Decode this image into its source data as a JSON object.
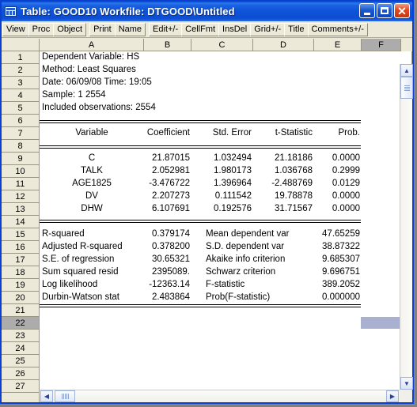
{
  "window": {
    "title": "Table: GOOD10   Workfile: DTGOOD\\Untitled",
    "icon": "table-icon",
    "buttons": {
      "minimize": "minimize",
      "maximize": "maximize",
      "close": "close"
    },
    "accent_color": "#0d4ed3",
    "close_color": "#c63711",
    "face_color": "#ece9d8"
  },
  "toolbar": {
    "groups": [
      [
        "View",
        "Proc",
        "Object"
      ],
      [
        "Print",
        "Name"
      ],
      [
        "Edit+/-",
        "CellFmt",
        "InsDel",
        "Grid+/-",
        "Title",
        "Comments+/-"
      ]
    ]
  },
  "sheet": {
    "columns": [
      "A",
      "B",
      "C",
      "D",
      "E",
      "F"
    ],
    "selected_column": "F",
    "selected_row": "22",
    "selected_cell": "F22",
    "selection_color": "#a9b0d0",
    "row_numbers": [
      "1",
      "2",
      "3",
      "4",
      "5",
      "6",
      "7",
      "8",
      "9",
      "10",
      "11",
      "12",
      "13",
      "14",
      "15",
      "16",
      "17",
      "18",
      "19",
      "20",
      "21",
      "22",
      "23",
      "24",
      "25",
      "26",
      "27"
    ]
  },
  "report": {
    "header_lines": [
      "Dependent Variable: HS",
      "Method: Least Squares",
      "Date: 06/09/08   Time: 19:05",
      "Sample: 1 2554",
      "Included observations: 2554"
    ],
    "table_headers": [
      "Variable",
      "Coefficient",
      "Std. Error",
      "t-Statistic",
      "Prob."
    ],
    "coefficients": [
      {
        "variable": "C",
        "coefficient": "21.87015",
        "std_error": "1.032494",
        "t_statistic": "21.18186",
        "prob": "0.0000"
      },
      {
        "variable": "TALK",
        "coefficient": "2.052981",
        "std_error": "1.980173",
        "t_statistic": "1.036768",
        "prob": "0.2999"
      },
      {
        "variable": "AGE1825",
        "coefficient": "-3.476722",
        "std_error": "1.396964",
        "t_statistic": "-2.488769",
        "prob": "0.0129"
      },
      {
        "variable": "DV",
        "coefficient": "2.207273",
        "std_error": "0.111542",
        "t_statistic": "19.78878",
        "prob": "0.0000"
      },
      {
        "variable": "DHW",
        "coefficient": "6.107691",
        "std_error": "0.192576",
        "t_statistic": "31.71567",
        "prob": "0.0000"
      }
    ],
    "summary": [
      {
        "left_label": "R-squared",
        "left_value": "0.379174",
        "right_label": "Mean dependent var",
        "right_value": "47.65259"
      },
      {
        "left_label": "Adjusted R-squared",
        "left_value": "0.378200",
        "right_label": "S.D. dependent var",
        "right_value": "38.87322"
      },
      {
        "left_label": "S.E. of regression",
        "left_value": "30.65321",
        "right_label": "Akaike info criterion",
        "right_value": "9.685307"
      },
      {
        "left_label": "Sum squared resid",
        "left_value": "2395089.",
        "right_label": "Schwarz criterion",
        "right_value": "9.696751"
      },
      {
        "left_label": "Log likelihood",
        "left_value": "-12363.14",
        "right_label": "F-statistic",
        "right_value": "389.2052"
      },
      {
        "left_label": "Durbin-Watson stat",
        "left_value": "2.483864",
        "right_label": "Prob(F-statistic)",
        "right_value": "0.000000"
      }
    ]
  },
  "chart_data": {
    "type": "table",
    "title": "Dependent Variable: HS — Least Squares regression output",
    "columns": [
      "Variable",
      "Coefficient",
      "Std. Error",
      "t-Statistic",
      "Prob."
    ],
    "rows": [
      [
        "C",
        21.87015,
        1.032494,
        21.18186,
        0.0
      ],
      [
        "TALK",
        2.052981,
        1.980173,
        1.036768,
        0.2999
      ],
      [
        "AGE1825",
        -3.476722,
        1.396964,
        -2.488769,
        0.0129
      ],
      [
        "DV",
        2.207273,
        0.111542,
        19.78878,
        0.0
      ],
      [
        "DHW",
        6.107691,
        0.192576,
        31.71567,
        0.0
      ]
    ],
    "diagnostics": {
      "R-squared": 0.379174,
      "Adjusted R-squared": 0.3782,
      "S.E. of regression": 30.65321,
      "Sum squared resid": 2395089,
      "Log likelihood": -12363.14,
      "Durbin-Watson stat": 2.483864,
      "Mean dependent var": 47.65259,
      "S.D. dependent var": 38.87322,
      "Akaike info criterion": 9.685307,
      "Schwarz criterion": 9.696751,
      "F-statistic": 389.2052,
      "Prob(F-statistic)": 0.0
    },
    "observations": 2554,
    "sample": "1 2554"
  }
}
